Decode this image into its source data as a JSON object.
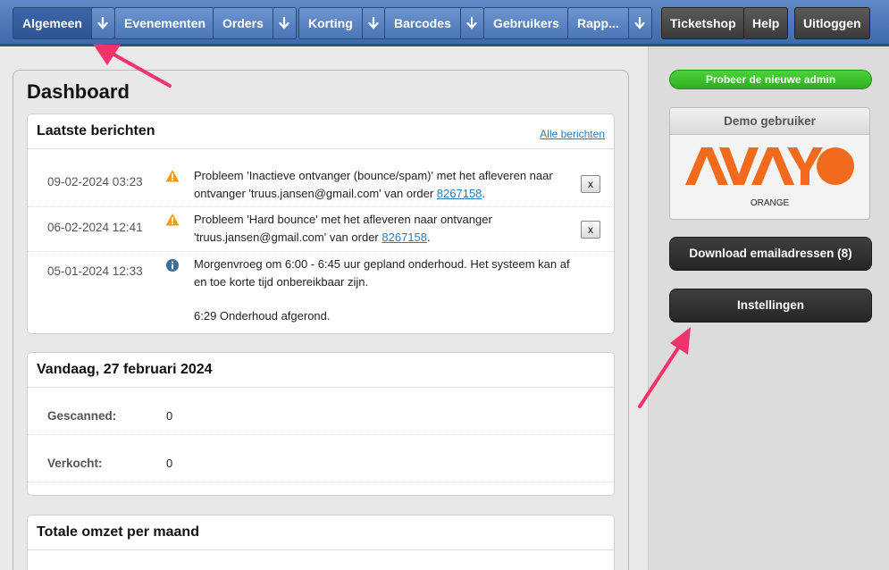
{
  "nav": {
    "items": [
      {
        "label": "Algemeen",
        "has_dropdown": true,
        "active": true
      },
      {
        "label": "Evenementen",
        "has_dropdown": false
      },
      {
        "label": "Orders",
        "has_dropdown": true
      },
      {
        "label": "Korting",
        "has_dropdown": true
      },
      {
        "label": "Barcodes",
        "has_dropdown": true
      },
      {
        "label": "Gebruikers",
        "has_dropdown": false
      },
      {
        "label": "Rapp...",
        "has_dropdown": true
      }
    ],
    "right_items": [
      {
        "label": "Ticketshop"
      },
      {
        "label": "Help"
      },
      {
        "label": "Uitloggen"
      }
    ],
    "dropdown_icon": "arrow-down-icon"
  },
  "page": {
    "title": "Dashboard"
  },
  "messages": {
    "title": "Laatste berichten",
    "all_link": "Alle berichten",
    "items": [
      {
        "date": "09-02-2024 03:23",
        "icon": "warning-icon",
        "line1": "Probleem 'Inactieve ontvanger (bounce/spam)' met het afleveren naar",
        "line2_pre": "ontvanger 'truus.jansen@gmail.com' van order ",
        "order": "8267158",
        "line2_post": ".",
        "close": "x"
      },
      {
        "date": "06-02-2024 12:41",
        "icon": "warning-icon",
        "line1": "Probleem 'Hard bounce' met het afleveren naar ontvanger",
        "line2_pre": "'truus.jansen@gmail.com' van order ",
        "order": "8267158",
        "line2_post": ".",
        "close": "x"
      },
      {
        "date": "05-01-2024 12:33",
        "icon": "info-icon",
        "line1": "Morgenvroeg om 6:00 - 6:45 uur gepland onderhoud. Het systeem kan af",
        "line2": "en toe korte tijd onbereikbaar zijn.",
        "line3": "6:29 Onderhoud afgerond."
      }
    ]
  },
  "today": {
    "title": "Vandaag, 27 februari 2024",
    "rows": [
      {
        "label": "Gescanned:",
        "value": "0"
      },
      {
        "label": "Verkocht:",
        "value": "0"
      }
    ]
  },
  "revenue": {
    "title": "Totale omzet per maand"
  },
  "sidebar": {
    "try_button": "Probeer de nieuwe admin",
    "demo_title": "Demo gebruiker",
    "logo_subtitle": "ORANGE",
    "logo_text": "AVAYO",
    "download_button": "Download emailadressen (8)",
    "settings_button": "Instellingen"
  },
  "colors": {
    "nav_blue": "#4b76b8",
    "green": "#2fae21",
    "dark_button": "#2e2e2e",
    "logo_orange": "#f26a1b",
    "annotation_arrow": "#f0336a",
    "warning": "#f19b18",
    "info": "#3b6f9c"
  }
}
